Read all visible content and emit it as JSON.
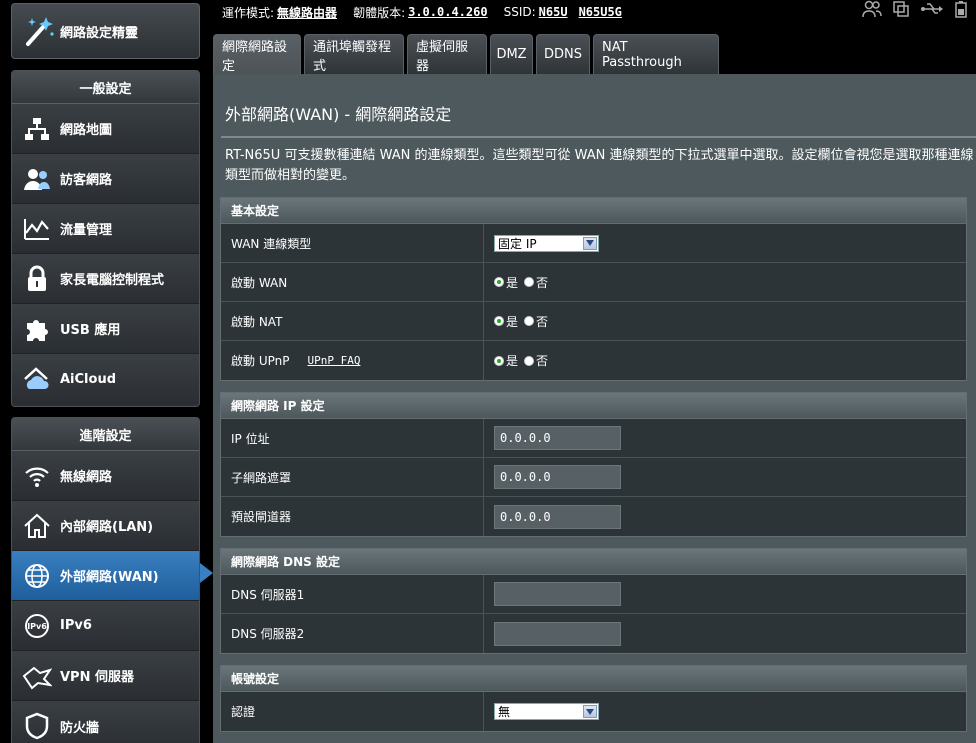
{
  "status": {
    "mode_label": "運作模式:",
    "mode_value": "無線路由器",
    "firmware_label": "韌體版本:",
    "firmware_value": "3.0.0.4.260",
    "ssid_label": "SSID:",
    "ssid_1": "N65U",
    "ssid_2": "N65U5G"
  },
  "sidebar": {
    "wizard_label": "網路設定精靈",
    "general_title": "一般設定",
    "general_items": [
      {
        "label": "網路地圖",
        "icon": "network-map-icon"
      },
      {
        "label": "訪客網路",
        "icon": "guest-network-icon"
      },
      {
        "label": "流量管理",
        "icon": "traffic-manager-icon"
      },
      {
        "label": "家長電腦控制程式",
        "icon": "lock-icon"
      },
      {
        "label": "USB 應用",
        "icon": "puzzle-icon"
      },
      {
        "label": "AiCloud",
        "icon": "cloud-icon"
      }
    ],
    "advanced_title": "進階設定",
    "advanced_items": [
      {
        "label": "無線網路",
        "icon": "wifi-icon"
      },
      {
        "label": "內部網路(LAN)",
        "icon": "home-icon"
      },
      {
        "label": "外部網路(WAN)",
        "icon": "globe-icon"
      },
      {
        "label": "IPv6",
        "icon": "ipv6-icon"
      },
      {
        "label": "VPN 伺服器",
        "icon": "vpn-icon"
      },
      {
        "label": "防火牆",
        "icon": "shield-icon"
      }
    ]
  },
  "tabs": [
    "網際網路設定",
    "通訊埠觸發程式",
    "虛擬伺服器",
    "DMZ",
    "DDNS",
    "NAT Passthrough"
  ],
  "main": {
    "title": "外部網路(WAN) - 網際網路設定",
    "description": "RT-N65U 可支援數種連結 WAN 的連線類型。這些類型可從 WAN 連線類型的下拉式選單中選取。設定欄位會視您是選取那種連線類型而做相對的變更。"
  },
  "basic": {
    "header": "基本設定",
    "wan_type_label": "WAN 連線類型",
    "wan_type_value": "固定 IP",
    "enable_wan_label": "啟動 WAN",
    "enable_nat_label": "啟動 NAT",
    "enable_upnp_label": "啟動 UPnP",
    "upnp_faq": "UPnP FAQ",
    "yes": "是",
    "no": "否"
  },
  "ip": {
    "header": "網際網路 IP 設定",
    "ip_label": "IP 位址",
    "ip_value": "0.0.0.0",
    "mask_label": "子網路遮罩",
    "mask_value": "0.0.0.0",
    "gw_label": "預設閘道器",
    "gw_value": "0.0.0.0"
  },
  "dns": {
    "header": "網際網路 DNS 設定",
    "dns1_label": "DNS 伺服器1",
    "dns1_value": "",
    "dns2_label": "DNS 伺服器2",
    "dns2_value": ""
  },
  "account": {
    "header": "帳號設定",
    "auth_label": "認證",
    "auth_value": "無"
  },
  "colors": {
    "active_blue": "#3a7fc0",
    "panel_bg": "#4d595d"
  }
}
